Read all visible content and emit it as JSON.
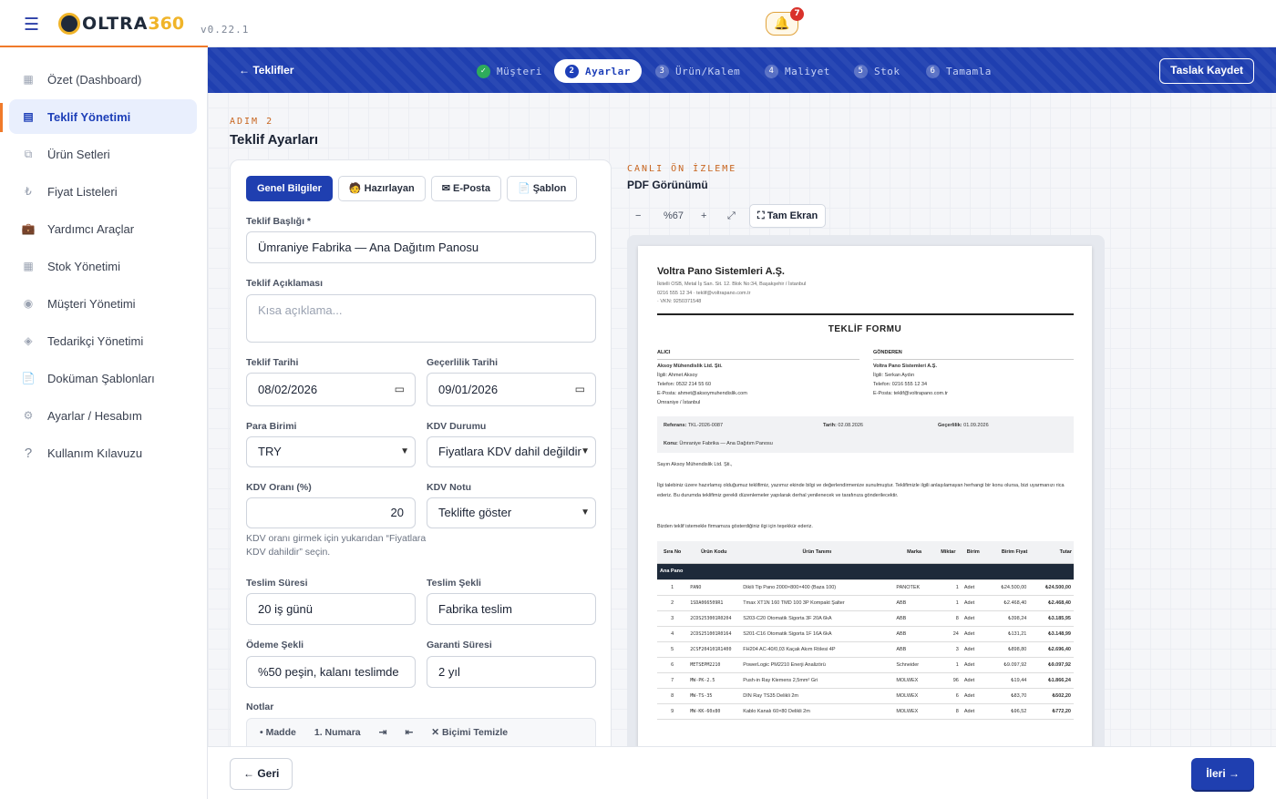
{
  "header": {
    "version": "v0.22.1",
    "notifications": "7",
    "logo_main": "OLTRA",
    "logo_num": "360"
  },
  "sidebar": {
    "items": [
      {
        "label": "Özet (Dashboard)",
        "icon": "▦"
      },
      {
        "label": "Teklif Yönetimi",
        "icon": "▤"
      },
      {
        "label": "Ürün Setleri",
        "icon": "⧉"
      },
      {
        "label": "Fiyat Listeleri",
        "icon": "₺"
      },
      {
        "label": "Yardımcı Araçlar",
        "icon": "💼"
      },
      {
        "label": "Stok Yönetimi",
        "icon": "▦"
      },
      {
        "label": "Müşteri Yönetimi",
        "icon": "◉"
      },
      {
        "label": "Tedarikçi Yönetimi",
        "icon": "◈"
      },
      {
        "label": "Doküman Şablonları",
        "icon": "📄"
      },
      {
        "label": "Ayarlar / Hesabım",
        "icon": "⚙"
      },
      {
        "label": "Kullanım Kılavuzu",
        "icon": "?"
      }
    ]
  },
  "wizard": {
    "back": "← Teklifler",
    "steps": [
      {
        "num": "✓",
        "label": "Müşteri"
      },
      {
        "num": "2",
        "label": "Ayarlar"
      },
      {
        "num": "3",
        "label": "Ürün/Kalem"
      },
      {
        "num": "4",
        "label": "Maliyet"
      },
      {
        "num": "5",
        "label": "Stok"
      },
      {
        "num": "6",
        "label": "Tamamla"
      }
    ],
    "draft": "Taslak Kaydet"
  },
  "step": {
    "label": "ADIM 2",
    "title": "Teklif Ayarları"
  },
  "tabs": [
    "Genel Bilgiler",
    "🧑 Hazırlayan",
    "✉ E-Posta",
    "📄 Şablon"
  ],
  "form": {
    "title_label": "Teklif Başlığı *",
    "title_value": "Ümraniye Fabrika — Ana Dağıtım Panosu",
    "desc_label": "Teklif Açıklaması",
    "desc_placeholder": "Kısa açıklama...",
    "date_label": "Teklif Tarihi",
    "date_value": "08/02/2026",
    "valid_label": "Geçerlilik Tarihi",
    "valid_value": "09/01/2026",
    "currency_label": "Para Birimi",
    "currency_value": "TRY",
    "vat_status_label": "KDV Durumu",
    "vat_status_value": "Fiyatlara KDV dahil değildir",
    "vat_rate_label": "KDV Oranı (%)",
    "vat_rate_value": "20",
    "vat_note_label": "KDV Notu",
    "vat_note_value": "Teklifte göster",
    "vat_help": "KDV oranı girmek için yukarıdan “Fiyatlara KDV dahildir” seçin.",
    "delivery_time_label": "Teslim Süresi",
    "delivery_time_value": "20 iş günü",
    "delivery_type_label": "Teslim Şekli",
    "delivery_type_value": "Fabrika teslim",
    "payment_label": "Ödeme Şekli",
    "payment_value": "%50 peşin, kalanı teslimde",
    "warranty_label": "Garanti Süresi",
    "warranty_value": "2 yıl",
    "notes_label": "Notlar",
    "toolbar": [
      "• Madde",
      "1. Numara",
      "⇥",
      "⇤",
      "✕ Biçimi Temizle"
    ]
  },
  "preview": {
    "label": "CANLI ÖN İZLEME",
    "title": "PDF Görünümü",
    "zoom_out": "−",
    "zoom": "%67",
    "zoom_in": "+",
    "expand": "⤢",
    "fullscreen": "⛶ Tam Ekran"
  },
  "pdf": {
    "company": "Voltra Pano Sistemleri A.Ş.",
    "addr1": "İkitelli OSB, Metal İş San. Sit. 12. Blok No:34, Başakşehir / İstanbul",
    "addr2": "0216 555 12 34 · teklif@voltrapano.com.tr",
    "addr3": "· VKN: 9250371548",
    "form_title": "TEKLİF FORMU",
    "buyer_h": "ALICI",
    "buyer": [
      "Aksoy Mühendislik Ltd. Şti.",
      "İlgili: Ahmet Aksoy",
      "Telefon: 0532 214 55 60",
      "E-Posta: ahmet@aksoymuhendislik.com",
      "Ümraniye / İstanbul"
    ],
    "sender_h": "GÖNDEREN",
    "sender": [
      "Voltra Pano Sistemleri A.Ş.",
      "İlgili: Serkan Aydın",
      "Telefon: 0216 555 12 34",
      "E-Posta: teklif@voltrapano.com.tr"
    ],
    "ref_label": "Referans:",
    "ref": "TKL-2026-0087",
    "date_label": "Tarih:",
    "date": "02.08.2026",
    "valid_label": "Geçerlilik:",
    "valid": "01.09.2026",
    "subject_label": "Konu:",
    "subject": "Ümraniye Fabrika — Ana Dağıtım Panosu",
    "greeting": "Sayın Aksoy Mühendislik Ltd. Şti.,",
    "body": "İlgi talebiniz üzere hazırlamış olduğumuz teklifimiz, yazımız ekinde bilgi ve değerlendirmenize sunulmuştur. Teklifimizle ilgili anlaşılamayan herhangi bir konu olursa, bizi uyarmanızı rica ederiz. Bu durumda teklifimiz gerekli düzenlemeler yapılarak derhal yenilenecek ve tarafınıza gönderilecektir.",
    "thanks": "Bizden teklif istemekle firmamıza gösterdiğiniz ilgi için teşekkür ederiz.",
    "cols": [
      "Sıra No",
      "Ürün Kodu",
      "Ürün Tanımı",
      "Marka",
      "Miktar",
      "Birim",
      "Birim Fiyat",
      "Tutar"
    ],
    "group": "Ana Pano",
    "rows": [
      [
        "1",
        "PANO",
        "Dikili Tip Pano 2000×800×400 (Baza 100)",
        "PANOTEK",
        "1",
        "Adet",
        "₺24.500,00",
        "₺24.500,00"
      ],
      [
        "2",
        "1SDA066509R1",
        "Tmax XT1N 160 TMD 100 3P Kompakt Şalter",
        "ABB",
        "1",
        "Adet",
        "₺2.468,40",
        "₺2.468,40"
      ],
      [
        "3",
        "2CDS253001R0204",
        "S203-C20 Otomatik Sigorta 3F 20A 6kA",
        "ABB",
        "8",
        "Adet",
        "₺398,24",
        "₺3.185,95"
      ],
      [
        "4",
        "2CDS251001R0164",
        "S201-C16 Otomatik Sigorta 1F 16A 6kA",
        "ABB",
        "24",
        "Adet",
        "₺131,21",
        "₺3.148,99"
      ],
      [
        "5",
        "2CSF204101R1400",
        "FH204 AC-40/0,03 Kaçak Akım Rölesi 4P",
        "ABB",
        "3",
        "Adet",
        "₺898,80",
        "₺2.696,40"
      ],
      [
        "6",
        "METSEPM2210",
        "PowerLogic PM2210 Enerji Analizörü",
        "Schneider",
        "1",
        "Adet",
        "₺9.097,92",
        "₺9.097,92"
      ],
      [
        "7",
        "MW-PK-2.5",
        "Push-in Ray Klemens 2,5mm² Gri",
        "MOLWEX",
        "96",
        "Adet",
        "₺19,44",
        "₺1.866,24"
      ],
      [
        "8",
        "MW-TS-35",
        "DIN Ray TS35 Delikli 2m",
        "MOLWEX",
        "6",
        "Adet",
        "₺83,70",
        "₺502,20"
      ],
      [
        "9",
        "MW-KK-60x80",
        "Kablo Kanalı 60×80 Delikli 2m",
        "MOLWEX",
        "8",
        "Adet",
        "₺96,52",
        "₺772,20"
      ]
    ]
  },
  "footer": {
    "back": "← Geri",
    "next": "İleri →"
  }
}
